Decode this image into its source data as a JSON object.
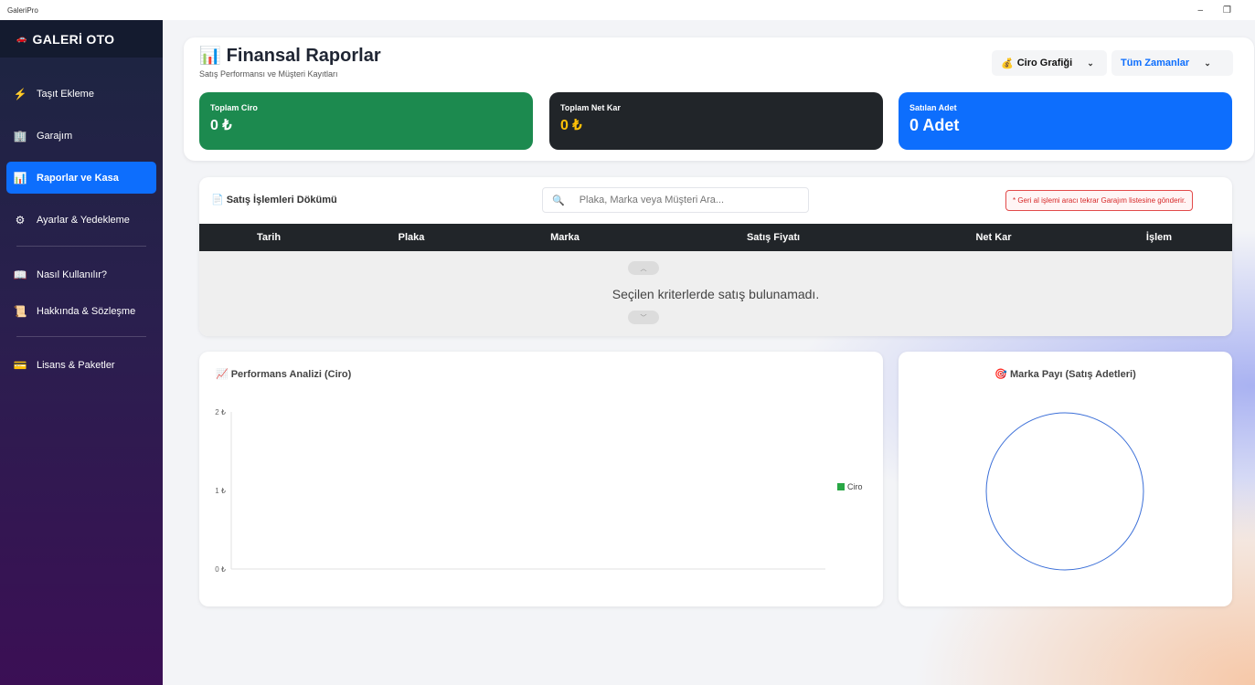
{
  "window": {
    "title": "GaleriPro",
    "minimize": "–",
    "restore": "❐"
  },
  "sidebar": {
    "brand": "GALERİ OTO",
    "brand_icon": "🚗",
    "items": [
      {
        "label": "Taşıt Ekleme",
        "icon": "⚡"
      },
      {
        "label": "Garajım",
        "icon": "🏢"
      },
      {
        "label": "Raporlar ve Kasa",
        "icon": "📊"
      },
      {
        "label": "Ayarlar & Yedekleme",
        "icon": "⚙"
      },
      {
        "label": "Nasıl Kullanılır?",
        "icon": "📖"
      },
      {
        "label": "Hakkında & Sözleşme",
        "icon": "📜"
      },
      {
        "label": "Lisans & Paketler",
        "icon": "💳"
      }
    ],
    "active_index": 2
  },
  "header": {
    "title": "Finansal Raporlar",
    "title_icon": "📊",
    "subtitle": "Satış Performansı ve Müşteri Kayıtları",
    "chart_select": {
      "icon": "💰",
      "value": "Ciro Grafiği"
    },
    "time_select": {
      "value": "Tüm Zamanlar"
    },
    "chevron": "⌄"
  },
  "stats": [
    {
      "label": "Toplam Ciro",
      "value": "0 ₺",
      "color": "#1c8a4f"
    },
    {
      "label": "Toplam Net Kar",
      "value": "0 ₺",
      "color": "#212529"
    },
    {
      "label": "Satılan Adet",
      "value": "0 Adet",
      "color": "#0d6efd"
    }
  ],
  "sales": {
    "title": "Satış İşlemleri Dökümü",
    "title_icon": "📄",
    "search_placeholder": "Plaka, Marka veya Müşteri Ara...",
    "note": "* Geri al işlemi aracı tekrar Garajım listesine gönderir.",
    "columns": [
      "Tarih",
      "Plaka",
      "Marka",
      "Satış Fiyatı",
      "Net Kar",
      "İşlem"
    ],
    "empty_message": "Seçilen kriterlerde satış bulunamadı.",
    "scroll_up": "︿",
    "scroll_down": "﹀"
  },
  "performance": {
    "title": "Performans Analizi (Ciro)",
    "title_icon": "📈"
  },
  "brand_share": {
    "title": "Marka Payı (Satış Adetleri)",
    "title_icon": "🎯"
  },
  "chart_data": [
    {
      "type": "line",
      "title": "Performans Analizi (Ciro)",
      "x": [],
      "series": [
        {
          "name": "Ciro",
          "values": [],
          "color": "#28a745"
        }
      ],
      "yticks": [
        "0 ₺",
        "1 ₺",
        "2 ₺"
      ],
      "ylim": [
        0,
        2
      ],
      "legend": "right",
      "grid": false
    },
    {
      "type": "pie",
      "title": "Marka Payı (Satış Adetleri)",
      "categories": [],
      "values": [],
      "outline_color": "#3b6fd8"
    }
  ]
}
